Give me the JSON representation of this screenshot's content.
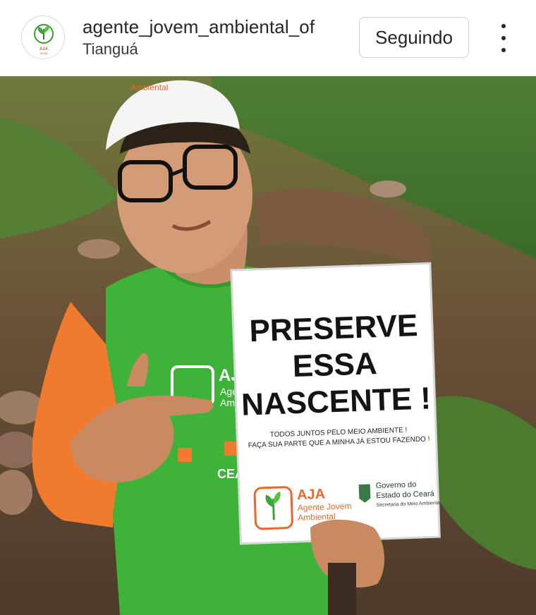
{
  "post": {
    "username": "agente_jovem_ambiental_of",
    "location": "Tianguá",
    "follow_label": "Seguindo",
    "avatar_logo_text": "AJA",
    "avatar_sub_text": "SEMA"
  },
  "photo": {
    "sign": {
      "line1": "PRESERVE",
      "line2": "ESSA",
      "line3": "NASCENTE !",
      "small1": "TODOS JUNTOS PELO MEIO AMBIENTE !",
      "small2": "FAÇA SUA PARTE QUE A MINHA JÁ ESTOU FAZENDO !",
      "logo_title": "AJA",
      "logo_line1": "Agente Jovem",
      "logo_line2": "Ambiental",
      "gov_line1": "Governo do",
      "gov_line2": "Estado do Ceará",
      "gov_line3": "Secretaria do Meio Ambiente"
    },
    "cap_text": "Ambiental",
    "shirt": {
      "title": "AJA",
      "line1": "Agente",
      "line2": "Ambien",
      "state": "CEAR"
    }
  },
  "colors": {
    "shirt_green": "#3fb23a",
    "sleeve_orange": "#f07a2e",
    "logo_orange": "#e8672a"
  }
}
